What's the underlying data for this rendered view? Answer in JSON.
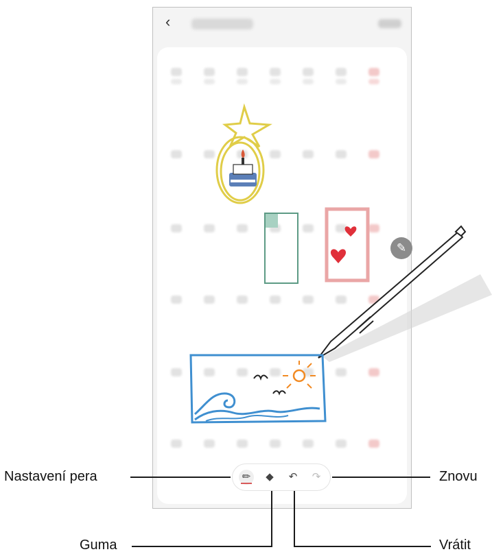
{
  "header": {
    "back_icon": "chevron-left-icon"
  },
  "toolbar": {
    "tools": [
      {
        "name": "pen-settings",
        "icon": "pen-icon",
        "selected": true
      },
      {
        "name": "eraser",
        "icon": "eraser-icon"
      },
      {
        "name": "undo",
        "icon": "undo-icon"
      },
      {
        "name": "redo",
        "icon": "redo-icon",
        "enabled": false
      }
    ]
  },
  "floating_button": {
    "icon": "pencil-icon"
  },
  "callouts": {
    "pen_settings": "Nastavení pera",
    "eraser": "Guma",
    "redo": "Znovu",
    "undo": "Vrátit"
  },
  "colors": {
    "accent_red": "#d95a5a",
    "star_yellow": "#e0cd48",
    "wave_blue": "#3f8fd0",
    "pen_gray": "#555555"
  }
}
